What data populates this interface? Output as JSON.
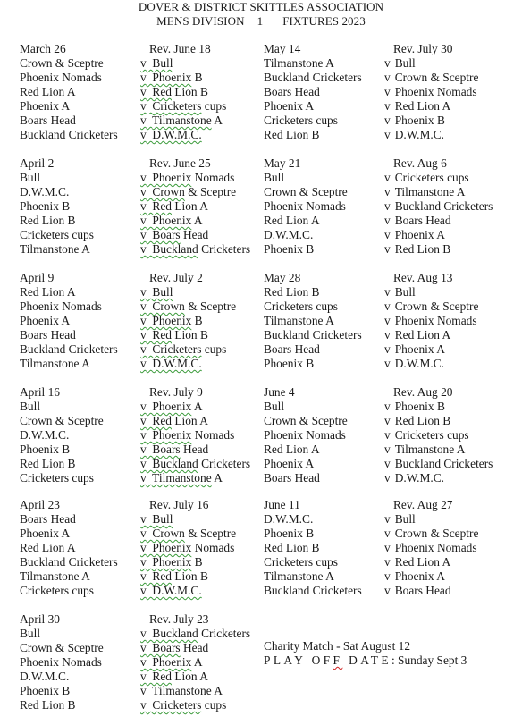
{
  "header": {
    "title": "DOVER & DISTRICT SKITTLES ASSOCIATION",
    "division_label": "MENS DIVISION",
    "division_number": "1",
    "fixtures_label": "FIXTURES 2023"
  },
  "versus_label": "v",
  "left_column": [
    {
      "date": "March 26",
      "rev": "Rev. June 18",
      "fixtures": [
        {
          "home": "Crown & Sceptre",
          "away_first": "Bull",
          "away_rest": "",
          "flagged": true
        },
        {
          "home": "Phoenix Nomads",
          "away_first": "Phoenix",
          "away_rest": " B",
          "flagged": true
        },
        {
          "home": "Red Lion A",
          "away_first": "Red",
          "away_rest": " Lion B",
          "flagged": true
        },
        {
          "home": "Phoenix A",
          "away_first": "Cricketers",
          "away_rest": " cups",
          "flagged": true
        },
        {
          "home": "Boars Head",
          "away_first": "Tilmanstone",
          "away_rest": " A",
          "flagged": true
        },
        {
          "home": "Buckland Cricketers",
          "away_first": "D.W.M.C.",
          "away_rest": "",
          "flagged": true
        }
      ]
    },
    {
      "date": "April 2",
      "rev": "Rev. June 25",
      "fixtures": [
        {
          "home": "Bull",
          "away_first": "Phoenix",
          "away_rest": " Nomads",
          "flagged": true
        },
        {
          "home": "D.W.M.C.",
          "away_first": "Crown",
          "away_rest": " & Sceptre",
          "flagged": true
        },
        {
          "home": "Phoenix B",
          "away_first": "Red",
          "away_rest": " Lion A",
          "flagged": true
        },
        {
          "home": "Red Lion B",
          "away_first": "Phoenix",
          "away_rest": " A",
          "flagged": true
        },
        {
          "home": "Cricketers cups",
          "away_first": "Boars",
          "away_rest": " Head",
          "flagged": true
        },
        {
          "home": "Tilmanstone A",
          "away_first": "Buckland",
          "away_rest": " Cricketers",
          "flagged": true
        }
      ]
    },
    {
      "date": "April 9",
      "rev": "Rev. July 2",
      "fixtures": [
        {
          "home": "Red Lion A",
          "away_first": "Bull",
          "away_rest": "",
          "flagged": true
        },
        {
          "home": "Phoenix Nomads",
          "away_first": "Crown",
          "away_rest": " & Sceptre",
          "flagged": true
        },
        {
          "home": "Phoenix A",
          "away_first": "Phoenix",
          "away_rest": " B",
          "flagged": true
        },
        {
          "home": "Boars Head",
          "away_first": "Red",
          "away_rest": " Lion B",
          "flagged": true
        },
        {
          "home": "Buckland Cricketers",
          "away_first": "Cricketers",
          "away_rest": " cups",
          "flagged": true
        },
        {
          "home": "Tilmanstone A",
          "away_first": "D.W.M.C.",
          "away_rest": "",
          "flagged": true
        }
      ]
    },
    {
      "date": "April 16",
      "rev": "Rev. July 9",
      "fixtures": [
        {
          "home": "Bull",
          "away_first": "Phoenix",
          "away_rest": " A",
          "flagged": true
        },
        {
          "home": "Crown & Sceptre",
          "away_first": "Red",
          "away_rest": " Lion A",
          "flagged": true
        },
        {
          "home": "D.W.M.C.",
          "away_first": "Phoenix",
          "away_rest": " Nomads",
          "flagged": true
        },
        {
          "home": "Phoenix B",
          "away_first": "Boars",
          "away_rest": " Head",
          "flagged": true
        },
        {
          "home": "Red Lion B",
          "away_first": "Buckland",
          "away_rest": " Cricketers",
          "flagged": true
        },
        {
          "home": "Cricketers cups",
          "away_first": "Tilmanstone",
          "away_rest": " A",
          "flagged": true
        }
      ]
    },
    {
      "date": "April 23",
      "rev": "Rev. July 16",
      "fixtures": [
        {
          "home": "Boars Head",
          "away_first": "Bull",
          "away_rest": "",
          "flagged": true
        },
        {
          "home": "Phoenix A",
          "away_first": "Crown",
          "away_rest": " & Sceptre",
          "flagged": true
        },
        {
          "home": "Red Lion A",
          "away_first": "Phoenix",
          "away_rest": " Nomads",
          "flagged": true
        },
        {
          "home": "Buckland Cricketers",
          "away_first": "Phoenix",
          "away_rest": " B",
          "flagged": true
        },
        {
          "home": "Tilmanstone A",
          "away_first": "Red",
          "away_rest": " Lion B",
          "flagged": true
        },
        {
          "home": "Cricketers cups",
          "away_first": "D.W.M.C.",
          "away_rest": "",
          "flagged": true
        }
      ]
    },
    {
      "date": "April 30",
      "rev": "Rev. July 23",
      "fixtures": [
        {
          "home": "Bull",
          "away_first": "Buckland",
          "away_rest": " Cricketers",
          "flagged": true
        },
        {
          "home": "Crown & Sceptre",
          "away_first": "Boars",
          "away_rest": " Head",
          "flagged": true
        },
        {
          "home": "Phoenix Nomads",
          "away_first": "Phoenix",
          "away_rest": " A",
          "flagged": true
        },
        {
          "home": "D.W.M.C.",
          "away_first": "Red",
          "away_rest": " Lion A",
          "flagged": true
        },
        {
          "home": "Phoenix B",
          "away_first": "Tilmanstone",
          "away_rest": " A",
          "flagged": false
        },
        {
          "home": "Red Lion B",
          "away_first": "Cricketers",
          "away_rest": " cups",
          "flagged": true
        }
      ]
    }
  ],
  "right_column": [
    {
      "date": "May 14",
      "rev": "Rev. July 30",
      "fixtures": [
        {
          "home": "Tilmanstone A",
          "away": "Bull"
        },
        {
          "home": "Buckland Cricketers",
          "away": "Crown & Sceptre"
        },
        {
          "home": "Boars Head",
          "away": "Phoenix Nomads"
        },
        {
          "home": "Phoenix A",
          "away": "Red Lion A"
        },
        {
          "home": "Cricketers cups",
          "away": "Phoenix B"
        },
        {
          "home": "Red Lion B",
          "away": "D.W.M.C."
        }
      ]
    },
    {
      "date": "May 21",
      "rev": "Rev. Aug 6",
      "fixtures": [
        {
          "home": "Bull",
          "away": "Cricketers cups"
        },
        {
          "home": "Crown & Sceptre",
          "away": "Tilmanstone A"
        },
        {
          "home": "Phoenix Nomads",
          "away": "Buckland Cricketers"
        },
        {
          "home": "Red Lion A",
          "away": "Boars Head"
        },
        {
          "home": "D.W.M.C.",
          "away": "Phoenix A"
        },
        {
          "home": "Phoenix B",
          "away": "Red Lion B"
        }
      ]
    },
    {
      "date": "May 28",
      "rev": "Rev. Aug 13",
      "fixtures": [
        {
          "home": "Red Lion B",
          "away": "Bull"
        },
        {
          "home": "Cricketers cups",
          "away": "Crown & Sceptre"
        },
        {
          "home": "Tilmanstone A",
          "away": "Phoenix Nomads"
        },
        {
          "home": "Buckland Cricketers",
          "away": "Red Lion A"
        },
        {
          "home": "Boars Head",
          "away": "Phoenix A"
        },
        {
          "home": "Phoenix B",
          "away": "D.W.M.C."
        }
      ]
    },
    {
      "date": "June 4",
      "rev": "Rev. Aug 20",
      "fixtures": [
        {
          "home": "Bull",
          "away": "Phoenix B"
        },
        {
          "home": "Crown & Sceptre",
          "away": "Red Lion B"
        },
        {
          "home": "Phoenix Nomads",
          "away": "Cricketers cups"
        },
        {
          "home": "Red Lion A",
          "away": "Tilmanstone A"
        },
        {
          "home": "Phoenix A",
          "away": "Buckland Cricketers"
        },
        {
          "home": "Boars Head",
          "away": "D.W.M.C."
        }
      ]
    },
    {
      "date": "June 11",
      "rev": "Rev. Aug 27",
      "fixtures": [
        {
          "home": "D.W.M.C.",
          "away": "Bull"
        },
        {
          "home": "Phoenix B",
          "away": "Crown & Sceptre"
        },
        {
          "home": "Red Lion B",
          "away": "Phoenix Nomads"
        },
        {
          "home": "Cricketers cups",
          "away": "Red Lion A"
        },
        {
          "home": "Tilmanstone A",
          "away": "Phoenix A"
        },
        {
          "home": "Buckland Cricketers",
          "away": "Boars Head"
        }
      ]
    }
  ],
  "notes": {
    "charity_match": "Charity Match - Sat August 12",
    "playoff_label_part1": "PLAY OF",
    "playoff_label_flagged": "F",
    "playoff_label_part2": " DATE",
    "playoff_value": ": Sunday Sept 3"
  },
  "colors": {
    "text": "#1a1a1a",
    "grammar_underline": "#3a9a3a",
    "spelling_underline": "#d02020"
  }
}
